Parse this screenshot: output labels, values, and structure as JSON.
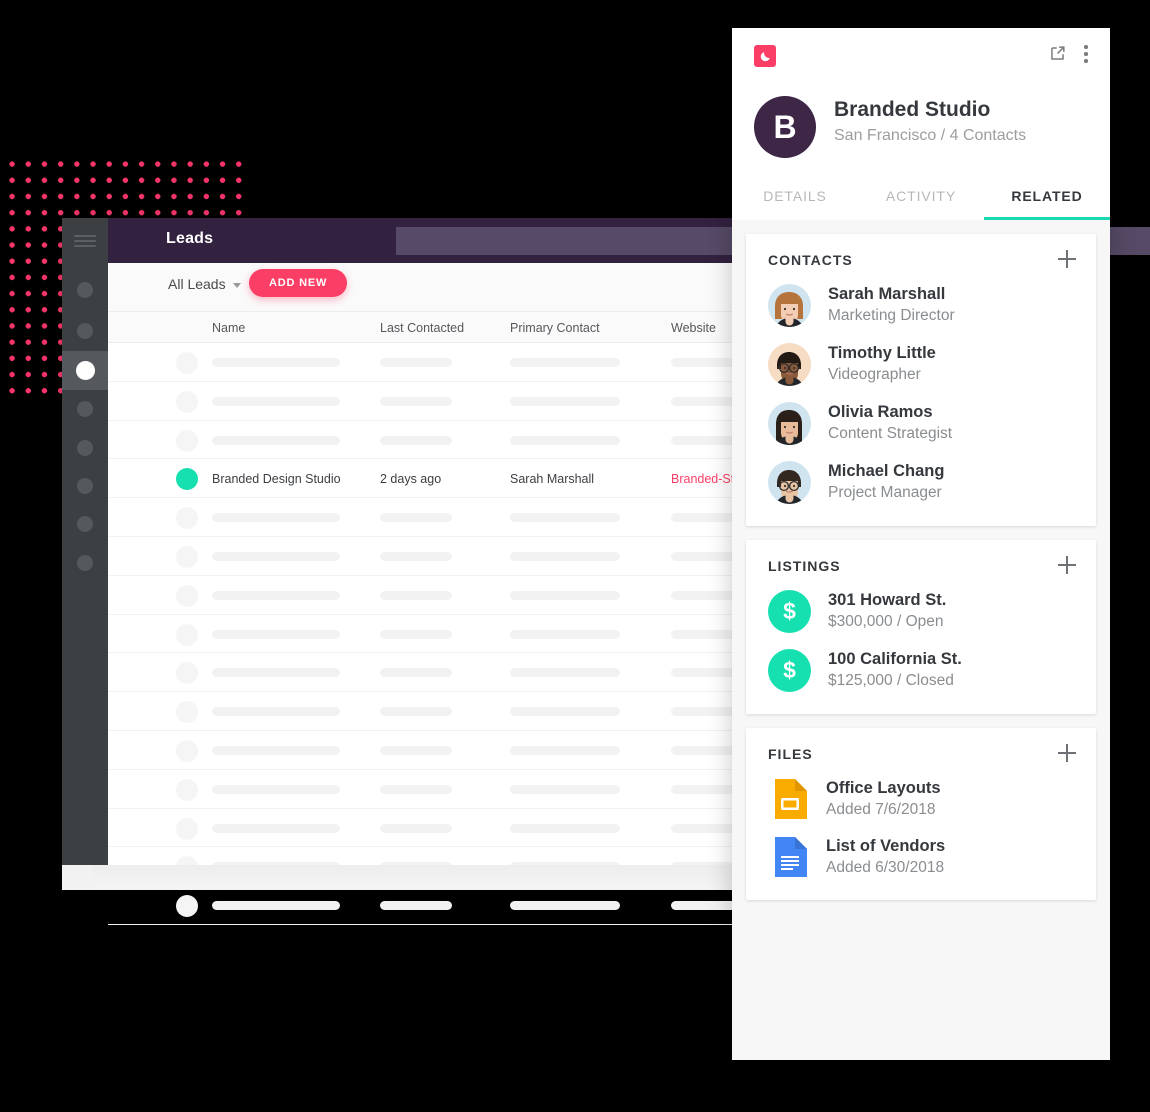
{
  "leads_window": {
    "app_title": "Leads",
    "search_placeholder": "",
    "search_value": "",
    "filter_label": "All Leads",
    "add_new_label": "ADD NEW",
    "columns": [
      "Name",
      "Last Contacted",
      "Primary Contact",
      "Website"
    ],
    "rows": [
      {
        "placeholder": true
      },
      {
        "placeholder": true
      },
      {
        "placeholder": true
      },
      {
        "placeholder": false,
        "name": "Branded Design Studio",
        "last_contacted": "2 days ago",
        "primary_contact": "Sarah Marshall",
        "website": "Branded-Studio.com"
      },
      {
        "placeholder": true
      },
      {
        "placeholder": true
      },
      {
        "placeholder": true
      },
      {
        "placeholder": true
      },
      {
        "placeholder": true
      },
      {
        "placeholder": true
      },
      {
        "placeholder": true
      },
      {
        "placeholder": true
      },
      {
        "placeholder": true
      },
      {
        "placeholder": true
      },
      {
        "placeholder": true
      }
    ],
    "nav_dot_count": 7,
    "nav_dot_active_index": 2
  },
  "detail_panel": {
    "logo_icon": "crescent-moon-icon",
    "open_external_icon": "open-external-icon",
    "more_menu_icon": "more-vertical-icon",
    "avatar_initial": "B",
    "company_name": "Branded Studio",
    "company_meta": "San Francisco / 4 Contacts",
    "tabs": [
      {
        "label": "DETAILS",
        "active": false
      },
      {
        "label": "ACTIVITY",
        "active": false
      },
      {
        "label": "RELATED",
        "active": true
      }
    ],
    "contacts_card": {
      "title": "CONTACTS",
      "add_icon": "plus-icon",
      "items": [
        {
          "name": "Sarah Marshall",
          "role": "Marketing Director"
        },
        {
          "name": "Timothy Little",
          "role": "Videographer"
        },
        {
          "name": "Olivia Ramos",
          "role": "Content Strategist"
        },
        {
          "name": "Michael Chang",
          "role": "Project Manager"
        }
      ]
    },
    "listings_card": {
      "title": "LISTINGS",
      "add_icon": "plus-icon",
      "items": [
        {
          "address": "301 Howard St.",
          "detail": "$300,000 / Open",
          "icon": "dollar-icon"
        },
        {
          "address": "100 California St.",
          "detail": "$125,000 / Closed",
          "icon": "dollar-icon"
        }
      ]
    },
    "files_card": {
      "title": "FILES",
      "add_icon": "plus-icon",
      "items": [
        {
          "name": "Office Layouts",
          "detail": "Added 7/6/2018",
          "icon": "google-slides-icon"
        },
        {
          "name": "List of Vendors",
          "detail": "Added 6/30/2018",
          "icon": "google-docs-icon"
        }
      ]
    }
  },
  "colors": {
    "accent_pink": "#fb3e66",
    "accent_teal": "#16e0b0",
    "header_purple": "#32213f",
    "avatar_purple": "#3d2646",
    "sidebar_dark": "#3c4043"
  }
}
